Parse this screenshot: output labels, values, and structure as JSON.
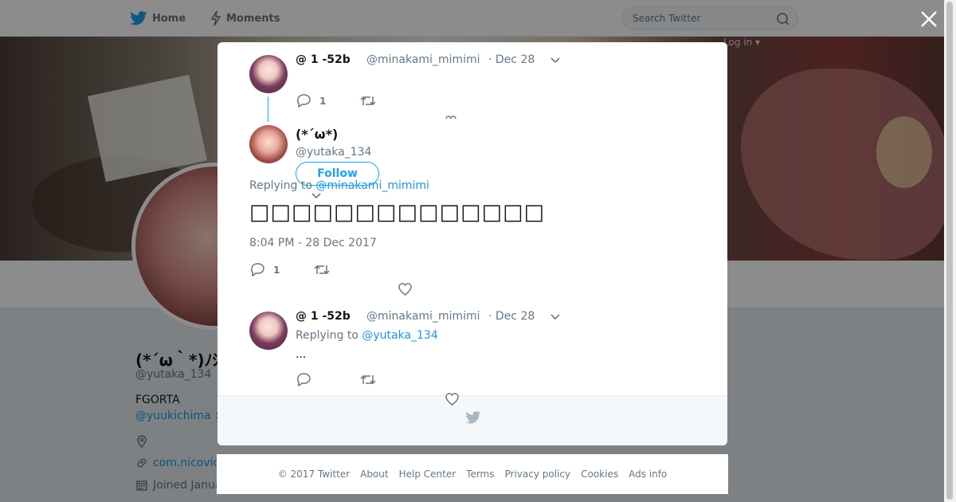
{
  "nav": {
    "home_label": "Home",
    "moments_label": "Moments",
    "search_placeholder": "Search Twitter",
    "login_label": "Log in ▾"
  },
  "profile": {
    "name": "(*´ω｀*)ﾉｼ",
    "handle": "@yutaka_134",
    "bio": "FGORTA",
    "bio_link": "@yuukichima ×",
    "website": "com.nicovic",
    "joined": "Joined Janua"
  },
  "modal": {
    "tweet1": {
      "name": "@ 1 -52b",
      "handle": "@minakami_mimimi",
      "date": "· Dec 28",
      "reply_count": "1"
    },
    "main": {
      "name": "(*´ω*)",
      "handle": "@yutaka_134",
      "follow_label": "Follow",
      "replying_prefix": "Replying to ",
      "replying_to": "@minakami_mimimi",
      "text": "□□□□□□□□□□□□□□",
      "timestamp": "8:04 PM - 28 Dec 2017",
      "reply_count": "1"
    },
    "tweet3": {
      "name": "@ 1 -52b",
      "handle": "@minakami_mimimi",
      "date": "· Dec 28",
      "replying_prefix": "Replying to ",
      "replying_to": "@yutaka_134",
      "text": "..."
    }
  },
  "footer": {
    "links": [
      "© 2017 Twitter",
      "About",
      "Help Center",
      "Terms",
      "Privacy policy",
      "Cookies",
      "Ads info"
    ]
  },
  "colors": {
    "accent": "#1da1f2",
    "link": "#1b95e0",
    "muted": "#657786"
  }
}
